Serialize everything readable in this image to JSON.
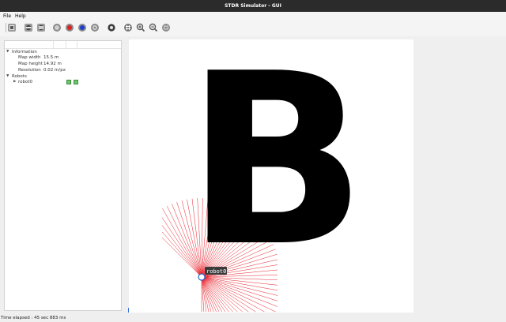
{
  "window": {
    "title": "STDR Simulator - GUI"
  },
  "menu": {
    "file": "File",
    "help": "Help"
  },
  "toolbar": {
    "icons": [
      "load-map-icon",
      "add-robot-icon",
      "load-robot-icon",
      "rfid-tag-icon",
      "co2-source-icon",
      "thermal-source-icon",
      "sound-source-icon",
      "properties-icon",
      "grid-icon",
      "zoom-in-icon",
      "zoom-out-icon",
      "fit-screen-icon"
    ]
  },
  "tree": {
    "information": {
      "label": "Information",
      "map_width_label": "Map width",
      "map_width_value": "15.5 m",
      "map_height_label": "Map height",
      "map_height_value": "14.92 m",
      "resolution_label": "Resolution",
      "resolution_value": "0.02 m/px"
    },
    "robots": {
      "label": "Robots",
      "items": [
        {
          "name": "robot0"
        }
      ]
    }
  },
  "map": {
    "letter": "B",
    "robot_label": "robot0",
    "laser_color": "#e8202a",
    "robot_color": "#2563c9"
  },
  "status": {
    "text": "Time elapsed : 45 sec 883 ms"
  }
}
